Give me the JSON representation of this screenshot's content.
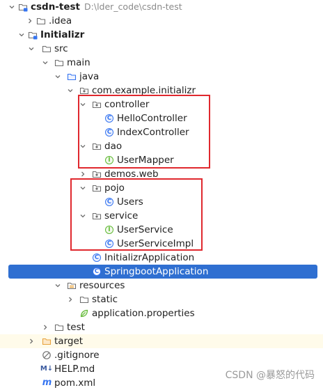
{
  "tree": {
    "project": {
      "name": "csdn-test",
      "path": "D:\\lder_code\\csdn-test"
    },
    "idea": ".idea",
    "module": "Initializr",
    "src": "src",
    "main": "main",
    "java": "java",
    "package": "com.example.initializr",
    "controller": "controller",
    "hello_controller": "HelloController",
    "index_controller": "IndexController",
    "dao": "dao",
    "user_mapper": "UserMapper",
    "demos_web": "demos.web",
    "pojo": "pojo",
    "users": "Users",
    "service": "service",
    "user_service": "UserService",
    "user_service_impl": "UserServiceImpl",
    "initializr_application": "InitializrApplication",
    "springboot_application": "SpringbootApplication",
    "resources": "resources",
    "static": "static",
    "application_properties": "application.properties",
    "test": "test",
    "target": "target",
    "gitignore": ".gitignore",
    "help_md": "HELP.md",
    "pom_xml": "pom.xml"
  },
  "icons": {
    "class_letter": "C",
    "interface_letter": "I",
    "markdown_glyph": "M↓",
    "maven_glyph": "m"
  },
  "watermark": "CSDN @暴怒的代码",
  "colors": {
    "selection": "#2f6fd1",
    "highlight_box": "#e0282e",
    "class_icon": "#3574f0",
    "interface_icon": "#5fb832",
    "excluded_tint": "#fffbea",
    "excluded_folder": "#e8a33d"
  }
}
